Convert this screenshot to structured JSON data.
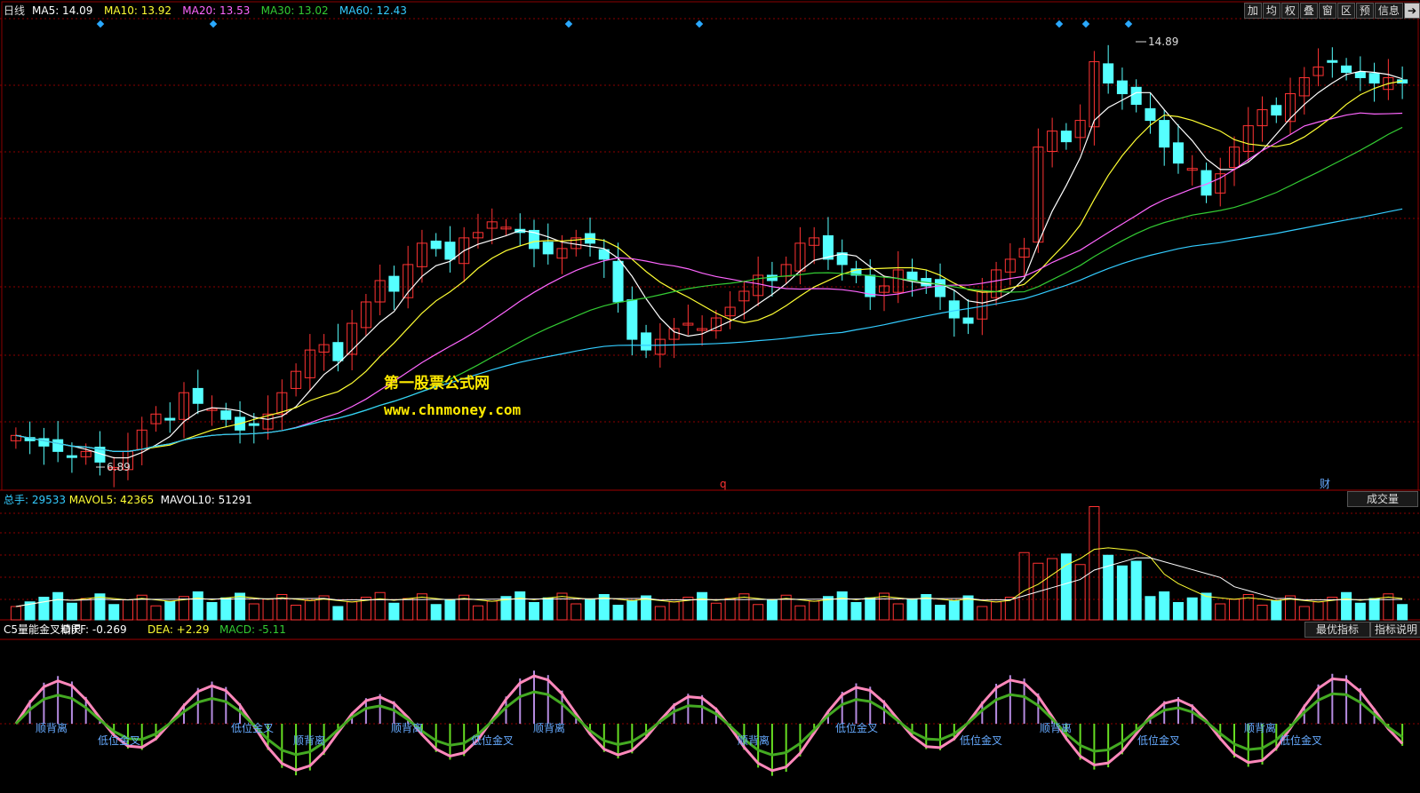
{
  "price_panel": {
    "period": "日线",
    "legend": [
      {
        "label": "MA5: 14.09",
        "color": "#ffffff"
      },
      {
        "label": "MA10: 13.92",
        "color": "#ffff33"
      },
      {
        "label": "MA20: 13.53",
        "color": "#ff66ff"
      },
      {
        "label": "MA30: 13.02",
        "color": "#33cc33"
      },
      {
        "label": "MA60: 12.43",
        "color": "#33ccff"
      }
    ],
    "high_label": "14.89",
    "low_label": "6.89",
    "marker_q": "q",
    "marker_cai": "财"
  },
  "toolbar": [
    "加",
    "均",
    "权",
    "叠",
    "窗",
    "区",
    "预",
    "信息"
  ],
  "watermark": {
    "line1": "第一股票公式网",
    "line2": "www.chnmoney.com"
  },
  "volume_panel": {
    "legend": [
      {
        "label": "总手: 29533",
        "color": "#33ccff"
      },
      {
        "label": "MAVOL5: 42365",
        "color": "#ffff33"
      },
      {
        "label": "MAVOL10: 51291",
        "color": "#ffffff"
      }
    ],
    "button": "成交量"
  },
  "indicator_panel": {
    "legend": [
      {
        "label": "C5量能金叉精灵",
        "color": "#ffffff"
      },
      {
        "label": "DIFF: -0.269",
        "color": "#ffffff"
      },
      {
        "label": "DEA: +2.29",
        "color": "#ffff33"
      },
      {
        "label": "MACD: -5.11",
        "color": "#33cc33"
      }
    ],
    "buttons": [
      "最优指标",
      "指标说明"
    ],
    "signals": [
      "顺背离",
      "低位金叉",
      "低位金叉",
      "顺背离",
      "顺背离",
      "低位金叉",
      "顺背离",
      "顺背离",
      "低位金叉",
      "低位金叉",
      "顺背离",
      "低位金叉",
      "顺背离",
      "低位金叉"
    ]
  },
  "colors": {
    "up": "#ff3333",
    "down": "#55ffff",
    "grid": "#8b0000",
    "bg": "#000000"
  },
  "chart_data": {
    "type": "candlestick",
    "price_range": [
      6.89,
      14.89
    ],
    "close_series": [
      7.5,
      7.4,
      7.3,
      7.2,
      7.1,
      7.2,
      7.0,
      6.9,
      7.2,
      7.6,
      7.9,
      7.8,
      8.3,
      8.1,
      8.0,
      7.8,
      7.6,
      7.7,
      7.9,
      8.3,
      8.7,
      9.1,
      9.2,
      8.9,
      9.6,
      10.0,
      10.4,
      10.2,
      10.7,
      11.1,
      11.0,
      10.8,
      11.2,
      11.3,
      11.5,
      11.4,
      11.3,
      11.0,
      10.9,
      11.0,
      11.2,
      11.1,
      10.8,
      10.0,
      9.3,
      9.1,
      9.3,
      9.5,
      9.6,
      9.5,
      9.7,
      9.9,
      10.2,
      10.5,
      10.4,
      10.7,
      11.1,
      11.2,
      10.8,
      10.7,
      10.5,
      10.1,
      10.3,
      10.6,
      10.4,
      10.3,
      10.1,
      9.7,
      9.6,
      10.2,
      10.6,
      10.8,
      11.0,
      12.9,
      13.2,
      13.0,
      13.4,
      14.5,
      14.1,
      13.9,
      13.7,
      13.4,
      12.9,
      12.6,
      12.5,
      12.0,
      12.4,
      12.9,
      13.3,
      13.6,
      13.5,
      13.9,
      14.2,
      14.4,
      14.5,
      14.3,
      14.2,
      14.1,
      14.2,
      14.1
    ]
  }
}
